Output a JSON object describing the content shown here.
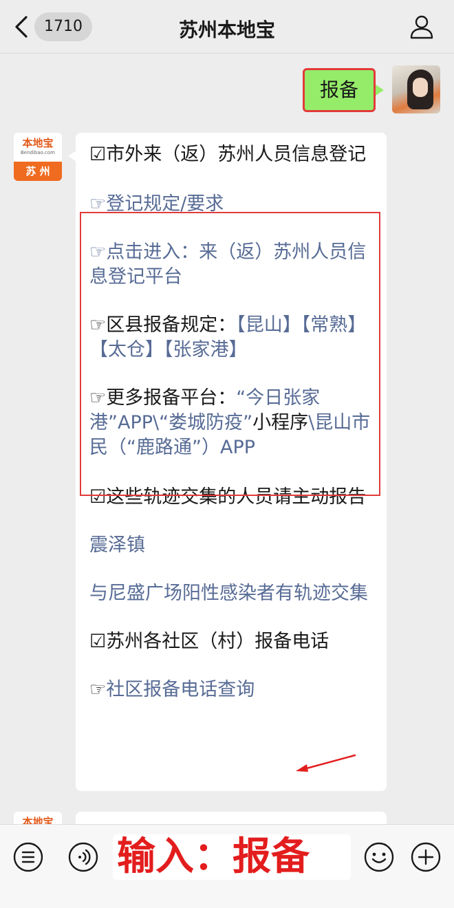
{
  "header": {
    "back_badge": "1710",
    "title": "苏州本地宝"
  },
  "outgoing_message": {
    "text": "报备"
  },
  "bot": {
    "avatar_top": "本地宝",
    "avatar_url_text": "Bendibao.com",
    "avatar_bottom": "苏 州"
  },
  "message": {
    "section1_title": "☑市外来（返）苏州人员信息登记",
    "link_register_rules": "☞登记规定/要求",
    "link_enter_prefix": "☞点击进入：",
    "link_enter_text": "来（返）苏州人员信息登记平台",
    "county_prefix": "☞区县报备规定：",
    "county_links": [
      "【昆山】",
      "【常熟】",
      "【太仓】",
      "【张家港】"
    ],
    "more_prefix": "☞更多报备平台：",
    "more_part1": "“今日张家港”APP\\“娄城防疫”",
    "more_part2": "小程序",
    "more_part3": "\\昆山市民（“鹿路通”）APP",
    "section2_title": "☑这些轨迹交集的人员请主动报告",
    "link_zhenze": "震泽镇",
    "link_nisheng": "与尼盛广场阳性感染者有轨迹交集",
    "section3_title": "☑苏州各社区（村）报备电话",
    "link_phone_prefix": "☞",
    "link_phone_text": "社区报备电话查询"
  },
  "input_bar": {
    "text": "输入：报备"
  },
  "colors": {
    "link": "#576b95",
    "bubble_out": "#95ec69",
    "highlight_red": "#e23a3a",
    "brand_orange": "#ef6b1f"
  }
}
